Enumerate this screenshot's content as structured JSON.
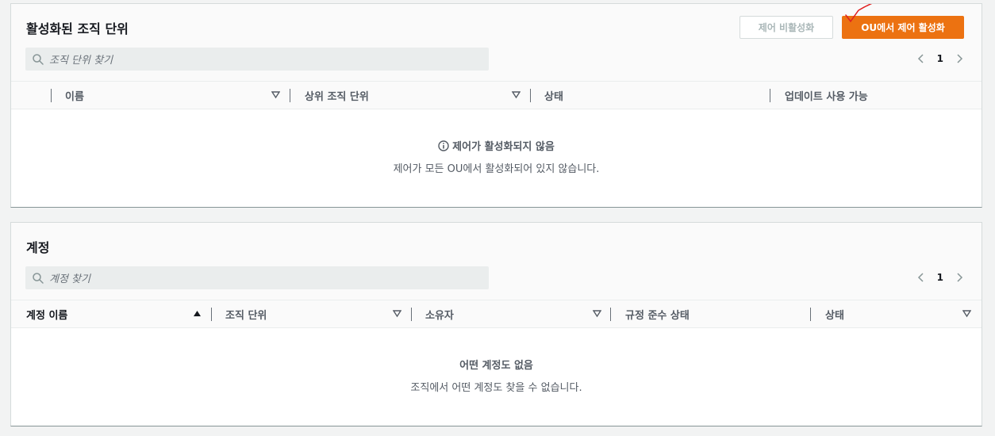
{
  "ou_panel": {
    "title": "활성화된 조직 단위",
    "disable_button": "제어 비활성화",
    "enable_button": "OU에서 제어 활성화",
    "search_placeholder": "조직 단위 찾기",
    "page": "1",
    "columns": [
      "이름",
      "상위 조직 단위",
      "상태",
      "업데이트 사용 가능"
    ],
    "empty_title": "제어가 활성화되지 않음",
    "empty_desc": "제어가 모든 OU에서 활성화되어 있지 않습니다."
  },
  "accounts_panel": {
    "title": "계정",
    "search_placeholder": "계정 찾기",
    "page": "1",
    "columns": [
      "계정 이름",
      "조직 단위",
      "소유자",
      "규정 준수 상태",
      "상태"
    ],
    "empty_title": "어떤 계정도 없음",
    "empty_desc": "조직에서 어떤 계정도 찾을 수 없습니다."
  },
  "colors": {
    "primary": "#ec7211",
    "disabled_text": "#aab7b8",
    "annotation": "#e02020"
  },
  "icons": {
    "search": "search-icon",
    "prev": "chevron-left-icon",
    "next": "chevron-right-icon",
    "sort_desc": "caret-down-icon",
    "sort_asc": "caret-up-icon",
    "info": "info-icon"
  }
}
